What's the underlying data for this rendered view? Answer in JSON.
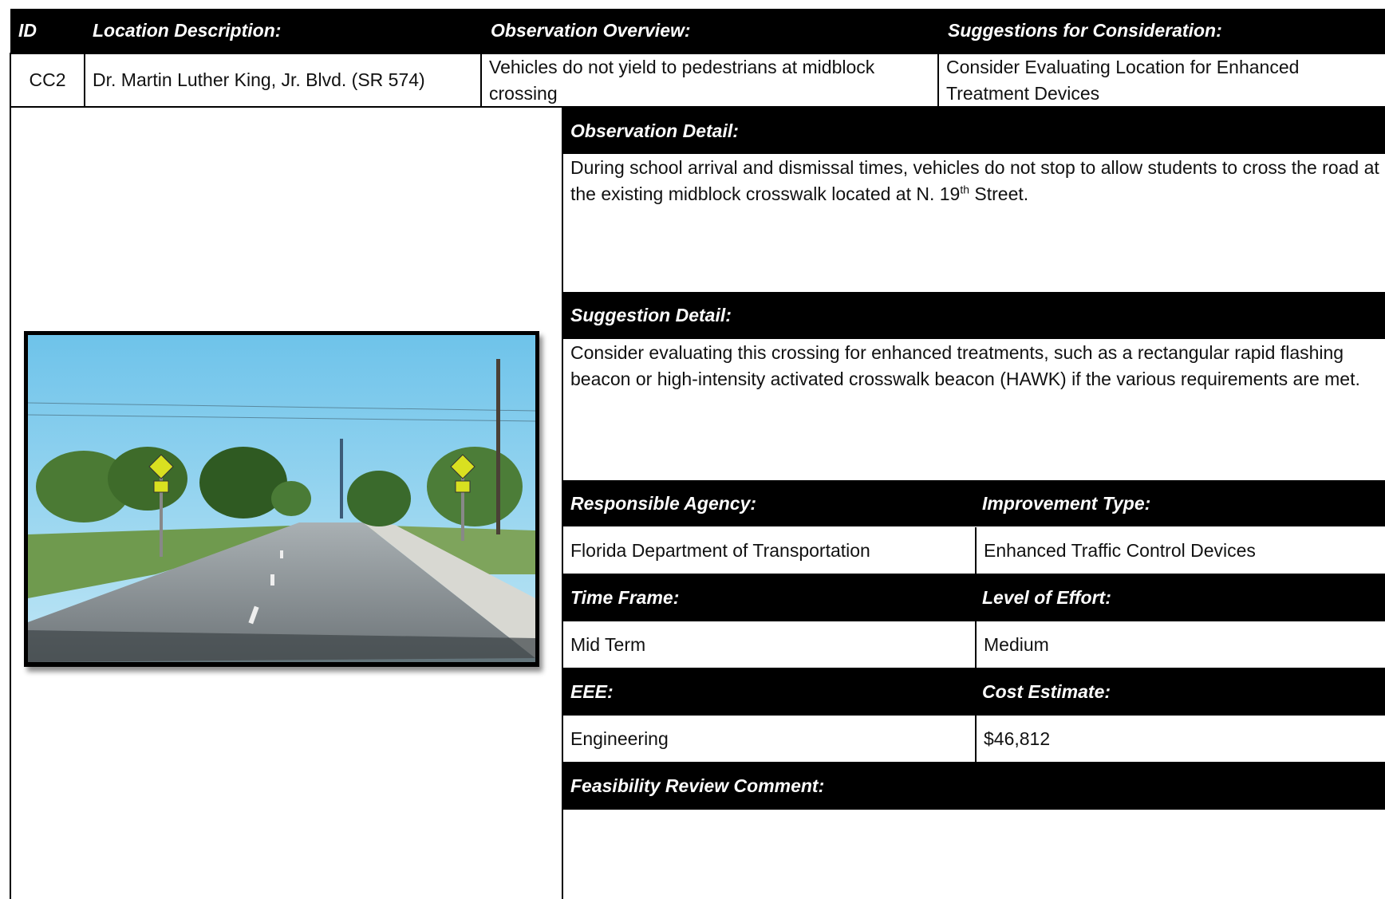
{
  "header": {
    "id": "ID",
    "location": "Location Description:",
    "overview": "Observation Overview:",
    "suggestions": "Suggestions for Consideration:"
  },
  "row": {
    "id": "CC2",
    "location": "Dr. Martin Luther King, Jr. Blvd. (SR 574)",
    "overview": "Vehicles do not yield to pedestrians at midblock crossing",
    "suggestion": "Consider Evaluating Location for Enhanced Treatment Devices"
  },
  "observation_detail": {
    "label": "Observation Detail:",
    "text_before": "During school arrival and dismissal times, vehicles do not stop to allow students to cross the road at the existing midblock crosswalk located at N. 19",
    "text_sup": "th",
    "text_after": " Street."
  },
  "suggestion_detail": {
    "label": "Suggestion Detail:",
    "text": "Consider evaluating this crossing for enhanced treatments, such as a rectangular rapid flashing beacon or high-intensity activated crosswalk beacon (HAWK) if the various requirements are met."
  },
  "fields": {
    "agency_label": "Responsible Agency:",
    "agency_value": "Florida Department of Transportation",
    "type_label": "Improvement Type:",
    "type_value": "Enhanced Traffic Control Devices",
    "timeframe_label": "Time Frame:",
    "timeframe_value": "Mid Term",
    "effort_label": "Level of Effort:",
    "effort_value": "Medium",
    "eee_label": "EEE:",
    "eee_value": "Engineering",
    "cost_label": "Cost Estimate:",
    "cost_value": "$46,812",
    "feasibility_label": "Feasibility Review Comment:",
    "feasibility_value": ""
  }
}
